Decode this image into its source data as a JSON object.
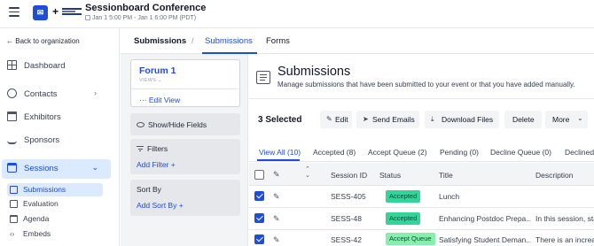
{
  "header": {
    "title": "Sessionboard Conference",
    "date": "Jan 1 5:00 PM - Jan 1 6:00 PM (PDT)",
    "plus": "+"
  },
  "sidebar": {
    "back_label": "Back to organization",
    "items": [
      {
        "label": "Dashboard",
        "icon": "dashboard-icon"
      },
      {
        "label": "Contacts",
        "icon": "contacts-icon",
        "chevron": "›"
      },
      {
        "label": "Exhibitors",
        "icon": "exhibitors-icon"
      },
      {
        "label": "Sponsors",
        "icon": "sponsors-icon"
      },
      {
        "label": "Sessions",
        "icon": "sessions-icon",
        "chevron": "⌄"
      }
    ],
    "sub_items": [
      {
        "label": "Submissions",
        "icon": "submissions-icon"
      },
      {
        "label": "Evaluation",
        "icon": "evaluation-icon"
      },
      {
        "label": "Agenda",
        "icon": "agenda-icon"
      },
      {
        "label": "Embeds",
        "icon": "embeds-icon"
      }
    ]
  },
  "subnav": {
    "crumb": "Submissions",
    "separator": "/",
    "tabs": [
      "Submissions",
      "Forms"
    ]
  },
  "view_panel": {
    "forum_name": "Forum 1",
    "views_label": "VIEWS",
    "edit_view": "Edit View",
    "show_hide_fields": "Show/Hide Fields",
    "filters_title": "Filters",
    "add_filter": "Add Filter",
    "sort_by_title": "Sort By",
    "add_sort_by": "Add Sort By"
  },
  "main": {
    "title": "Submissions",
    "description": "Manage submissions that have been submitted to your event or that you have added manually.",
    "selected_count": "3 Selected",
    "toolbar": {
      "edit": "Edit",
      "send_emails": "Send Emails",
      "download_files": "Download Files",
      "delete": "Delete",
      "more": "More"
    },
    "view_tabs": [
      "View All (10)",
      "Accepted (8)",
      "Accept Queue (2)",
      "Pending (0)",
      "Decline Queue (0)",
      "Declined"
    ]
  },
  "table": {
    "columns": [
      "Session ID",
      "Status",
      "Title",
      "Description"
    ],
    "rows": [
      {
        "session_id": "SESS-405",
        "status": "Accepted",
        "title": "Lunch",
        "description": ""
      },
      {
        "session_id": "SESS-48",
        "status": "Accepted",
        "title": "Enhancing Postdoc Prepa...",
        "description": "In this session, sta"
      },
      {
        "session_id": "SESS-42",
        "status": "Accept Queue",
        "title": "Satisfying Student Deman...",
        "description": "There is an increa"
      }
    ]
  },
  "colors": {
    "accent": "#1d4ed8",
    "accepted_badge": "#34d399",
    "accept_queue_badge": "#86efac"
  }
}
